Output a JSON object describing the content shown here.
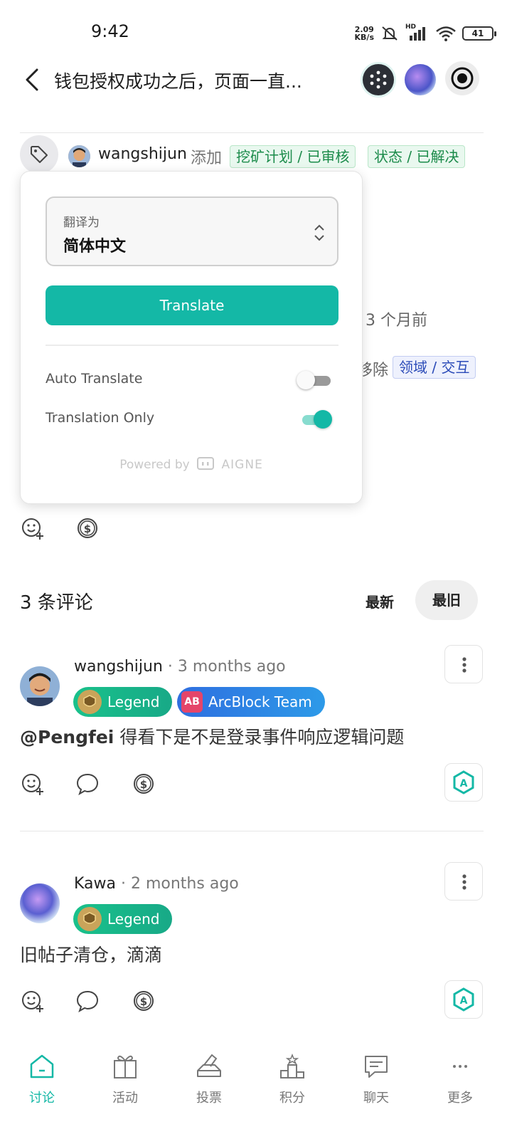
{
  "status_bar": {
    "time": "9:42",
    "net_speed_value": "2.09",
    "net_speed_unit": "KB/s",
    "battery": "41",
    "signal_label": "HD"
  },
  "header": {
    "title": "钱包授权成功之后，页面一直..."
  },
  "tag_event": {
    "user": "wangshijun",
    "action": "添加",
    "tags": [
      "挖矿计划 / 已审核",
      "状态 / 已解决"
    ]
  },
  "background_event": {
    "time_ago": "3 个月前",
    "action": "移除",
    "tag": "领域 / 交互"
  },
  "translate_popup": {
    "select_label": "翻译为",
    "select_value": "简体中文",
    "translate_button": "Translate",
    "auto_translate_label": "Auto Translate",
    "auto_translate_on": false,
    "translation_only_label": "Translation Only",
    "translation_only_on": true,
    "powered_by": "Powered by",
    "brand": "AIGNE"
  },
  "comments_section": {
    "count_label": "3 条评论",
    "sort_newest": "最新",
    "sort_oldest": "最旧"
  },
  "comments": [
    {
      "author": "wangshijun",
      "time": "3 months ago",
      "badges": [
        {
          "label": "Legend"
        },
        {
          "label": "ArcBlock Team",
          "icon_text": "AB"
        }
      ],
      "mention": "@Pengfei",
      "body": " 得看下是不是登录事件响应逻辑问题"
    },
    {
      "author": "Kawa",
      "time": "2 months ago",
      "badges": [
        {
          "label": "Legend"
        }
      ],
      "body": "旧帖子清仓，滴滴"
    }
  ],
  "bottom_nav": [
    {
      "label": "讨论",
      "icon": "home-icon",
      "active": true
    },
    {
      "label": "活动",
      "icon": "gift-icon",
      "active": false
    },
    {
      "label": "投票",
      "icon": "vote-icon",
      "active": false
    },
    {
      "label": "积分",
      "icon": "podium-icon",
      "active": false
    },
    {
      "label": "聊天",
      "icon": "chat-icon",
      "active": false
    },
    {
      "label": "更多",
      "icon": "more-icon",
      "active": false
    }
  ],
  "colors": {
    "accent": "#14b8a6",
    "legend_badge": "#19c18b",
    "team_badge": "#2d86e6"
  }
}
